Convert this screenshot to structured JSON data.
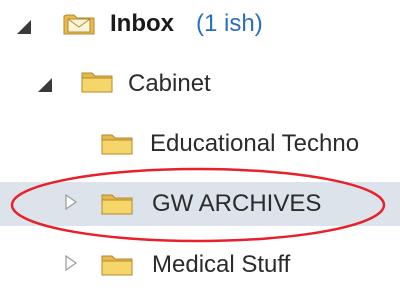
{
  "folder_tree": {
    "items": [
      {
        "label": "Inbox",
        "unread": "(1 ish)",
        "expander": "expanded-triangle-icon"
      },
      {
        "label": "Cabinet",
        "expander": "expanded-triangle-icon"
      },
      {
        "label": "Educational Techno"
      },
      {
        "label": "GW ARCHIVES",
        "expander": "collapsed-triangle-icon",
        "selected": true
      },
      {
        "label": "Medical Stuff",
        "expander": "collapsed-triangle-icon"
      }
    ]
  },
  "colors": {
    "highlight_row": "#dde3ea",
    "annotation": "#e8202a",
    "unread_count": "#2a6fbe",
    "folder": "#f2cf5b"
  }
}
